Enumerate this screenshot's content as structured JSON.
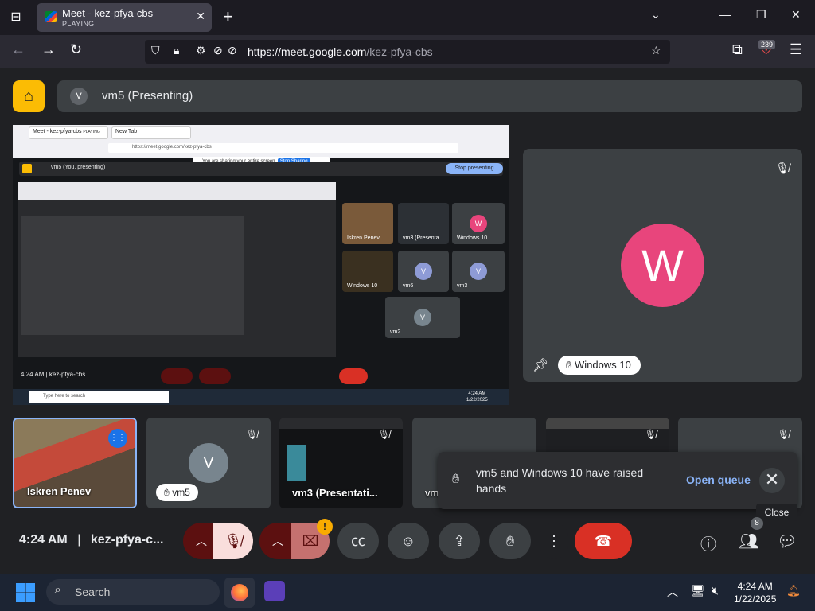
{
  "browser": {
    "tab_title": "Meet - kez-pfya-cbs",
    "tab_status": "PLAYING",
    "url_host": "https://meet.google.com",
    "url_path": "/kez-pfya-cbs",
    "extension_badge": "239"
  },
  "meet": {
    "presenting_label": "vm5 (Presenting)",
    "presenter_initial": "V",
    "pinned": {
      "name": "Windows 10",
      "initial": "W"
    },
    "strip": [
      {
        "name": "Iskren Penev"
      },
      {
        "name": "vm5",
        "initial": "V"
      },
      {
        "name": "vm3 (Presentati..."
      },
      {
        "name": "vm"
      }
    ],
    "toast": {
      "message": "vm5 and Windows 10 have raised hands",
      "open_queue": "Open queue",
      "close_tooltip": "Close"
    },
    "controls": {
      "time": "4:24 AM",
      "separator": "|",
      "meeting_code": "kez-pfya-c...",
      "people_count": "8",
      "camera_warning": "!"
    }
  },
  "shared_screen": {
    "tab1": "Meet - kez-pfya-cbs",
    "tab1_status": "PLAYING",
    "tab2": "New Tab",
    "url": "https://meet.google.com/kez-pfya-cbs",
    "info": "You are sharing your entire screen.",
    "info_btn": "Stop Sharing",
    "bar_label": "vm5 (You, presenting)",
    "stop_btn": "Stop presenting",
    "time_code": "4:24 AM  |  kez-pfya-cbs",
    "tiles": [
      {
        "name": "Iskren Penev"
      },
      {
        "name": "vm3 (Presenta..."
      },
      {
        "name": "Windows 10",
        "initial": "W"
      },
      {
        "name": "Windows 10"
      },
      {
        "name": "vm6",
        "initial": "V"
      },
      {
        "name": "vm3",
        "initial": "V"
      },
      {
        "name": "vm2",
        "initial": "V"
      }
    ],
    "search": "Type here to search",
    "clock_time": "4:24 AM",
    "clock_date": "1/22/2025"
  },
  "taskbar": {
    "search": "Search",
    "time": "4:24 AM",
    "date": "1/22/2025"
  }
}
